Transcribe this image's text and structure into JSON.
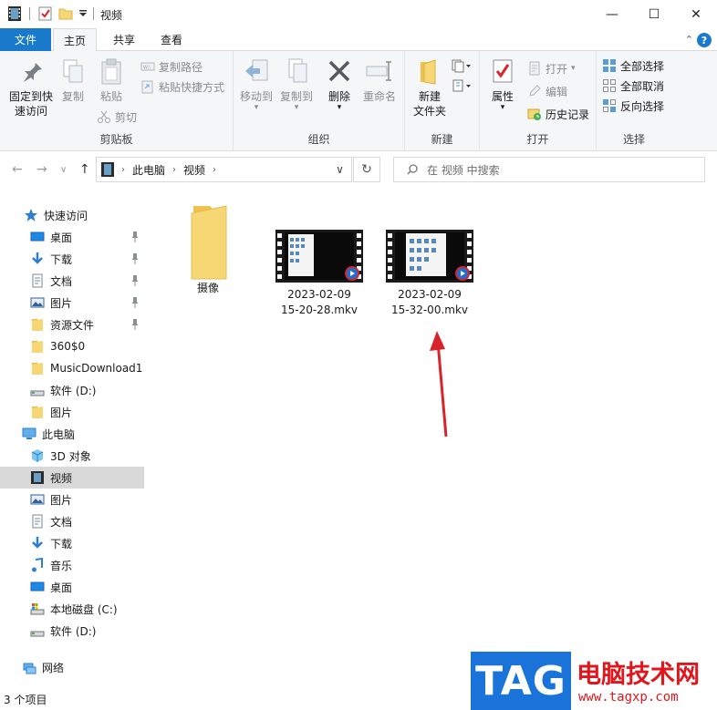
{
  "window": {
    "title": "视频",
    "minimize": "—",
    "maximize": "☐",
    "close": "✕"
  },
  "tabs": {
    "file": "文件",
    "home": "主页",
    "share": "共享",
    "view": "查看",
    "help": "?"
  },
  "ribbon": {
    "clipboard": {
      "label": "剪贴板",
      "pin_quick_access_1": "固定到快",
      "pin_quick_access_2": "速访问",
      "copy": "复制",
      "paste": "粘贴",
      "copy_path": "复制路径",
      "paste_shortcut": "粘贴快捷方式",
      "cut": "剪切"
    },
    "organize": {
      "label": "组织",
      "move_to": "移动到",
      "copy_to": "复制到",
      "delete": "删除",
      "rename": "重命名"
    },
    "new": {
      "label": "新建",
      "new_folder_1": "新建",
      "new_folder_2": "文件夹"
    },
    "open": {
      "label": "打开",
      "properties": "属性",
      "open": "打开",
      "edit": "编辑",
      "history": "历史记录"
    },
    "select": {
      "label": "选择",
      "select_all": "全部选择",
      "select_none": "全部取消",
      "invert": "反向选择"
    }
  },
  "address": {
    "crumbs": [
      "此电脑",
      "视频"
    ],
    "search_placeholder": "在 视频 中搜索"
  },
  "nav": {
    "quick_access": "快速访问",
    "items": [
      {
        "label": "桌面",
        "pinned": true
      },
      {
        "label": "下载",
        "pinned": true
      },
      {
        "label": "文档",
        "pinned": true
      },
      {
        "label": "图片",
        "pinned": true
      },
      {
        "label": "资源文件",
        "pinned": true
      },
      {
        "label": "360$0",
        "pinned": false
      },
      {
        "label": "MusicDownload1",
        "pinned": false
      },
      {
        "label": "软件 (D:)",
        "pinned": false
      },
      {
        "label": "图片",
        "pinned": false
      }
    ],
    "this_pc": "此电脑",
    "pc_items": [
      "3D 对象",
      "视频",
      "图片",
      "文档",
      "下载",
      "音乐",
      "桌面",
      "本地磁盘 (C:)",
      "软件 (D:)"
    ],
    "network": "网络"
  },
  "files": [
    {
      "name": "摄像",
      "type": "folder"
    },
    {
      "name_line1": "2023-02-09",
      "name_line2": "15-20-28.mkv",
      "type": "video"
    },
    {
      "name_line1": "2023-02-09",
      "name_line2": "15-32-00.mkv",
      "type": "video"
    }
  ],
  "status": {
    "item_count": "3 个项目"
  },
  "watermark": {
    "tag": "TAG",
    "site_name": "电脑技术网",
    "url": "www.tagxp.com"
  },
  "colors": {
    "accent": "#1979ca",
    "selection": "#d9d9d9",
    "annotation_arrow": "#d9232a"
  }
}
